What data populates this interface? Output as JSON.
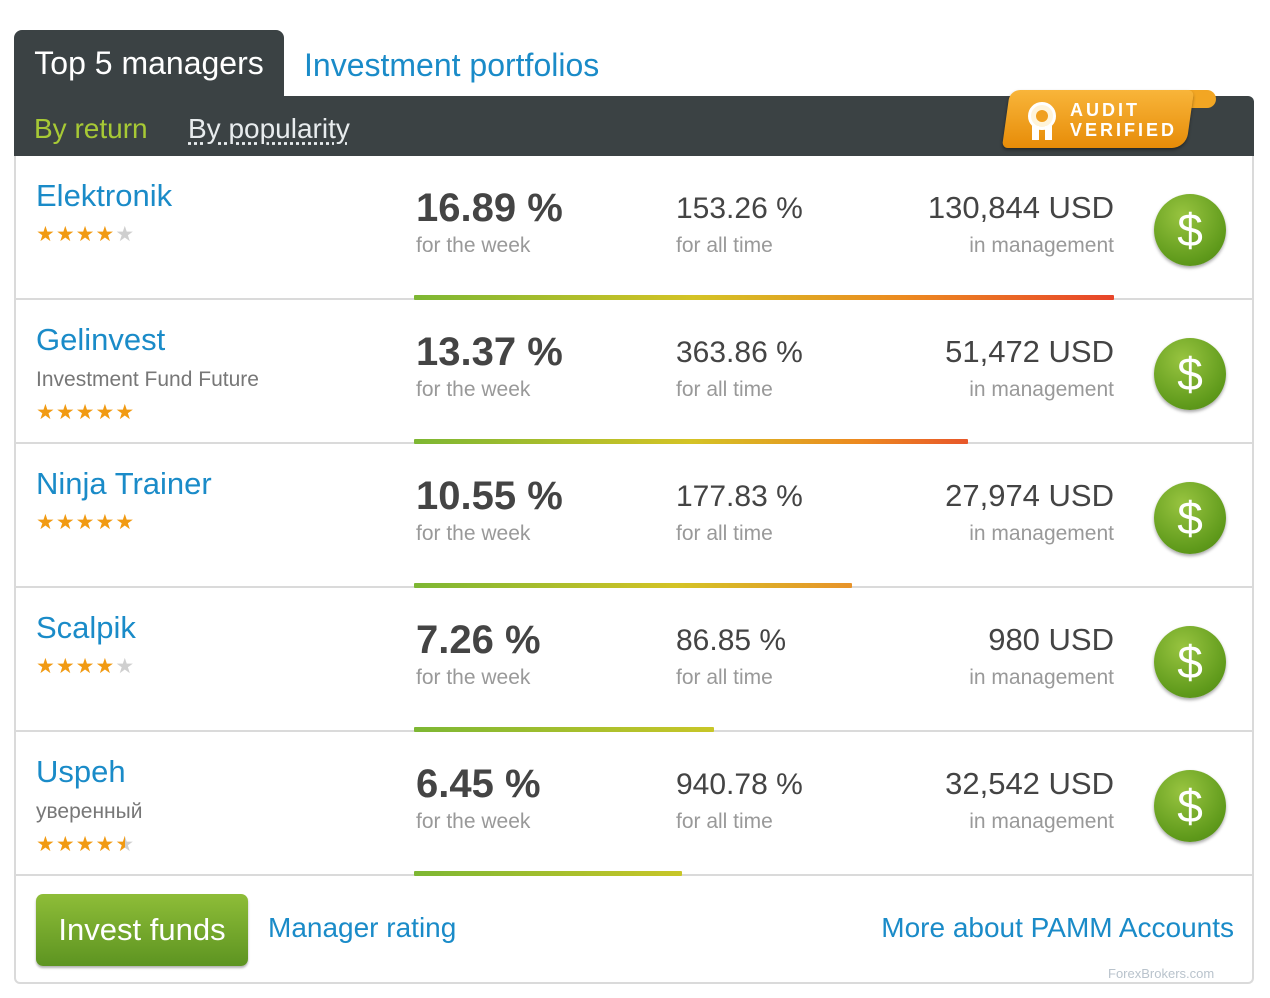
{
  "tabs": {
    "active": "Top 5 managers",
    "other": "Investment portfolios"
  },
  "subtabs": {
    "active": "By return",
    "other": "By popularity"
  },
  "badge": {
    "line1": "AUDIT",
    "line2": "VERIFIED"
  },
  "labels": {
    "week": "for the week",
    "all_time": "for all time",
    "management": "in management"
  },
  "managers": [
    {
      "name": "Elektronik",
      "subtitle": "",
      "rating": 4,
      "week": "16.89 %",
      "all_time": "153.26 %",
      "management": "130,844 USD"
    },
    {
      "name": "Gelinvest",
      "subtitle": "Investment Fund Future",
      "rating": 5,
      "week": "13.37 %",
      "all_time": "363.86 %",
      "management": "51,472 USD"
    },
    {
      "name": "Ninja Trainer",
      "subtitle": "",
      "rating": 5,
      "week": "10.55 %",
      "all_time": "177.83 %",
      "management": "27,974 USD"
    },
    {
      "name": "Scalpik",
      "subtitle": "",
      "rating": 4,
      "week": "7.26 %",
      "all_time": "86.85 %",
      "management": "980 USD"
    },
    {
      "name": "Uspeh",
      "subtitle": "уверенный",
      "rating": 4.5,
      "week": "6.45 %",
      "all_time": "940.78 %",
      "management": "32,542 USD"
    }
  ],
  "dollar_symbol": "$",
  "footer": {
    "invest_button": "Invest funds",
    "rating_link": "Manager rating",
    "more_link": "More about PAMM Accounts"
  },
  "watermark": "ForexBrokers.com"
}
